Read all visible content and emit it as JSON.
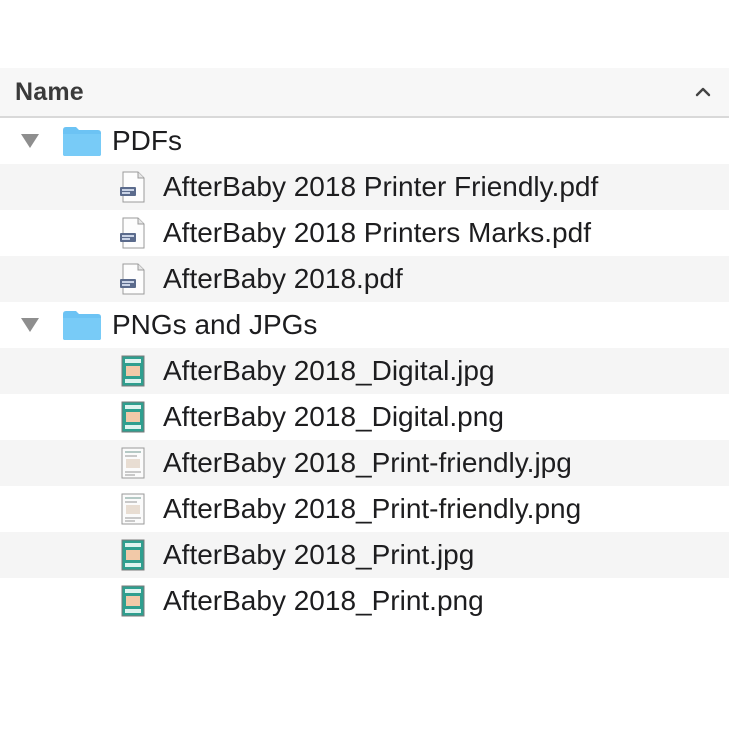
{
  "header": {
    "column_name": "Name",
    "sort_icon": "chevron-up-icon"
  },
  "folders": [
    {
      "name": "PDFs",
      "expanded": true,
      "files": [
        {
          "name": "AfterBaby 2018 Printer Friendly.pdf",
          "icon": "pdf-file-icon"
        },
        {
          "name": "AfterBaby 2018 Printers Marks.pdf",
          "icon": "pdf-file-icon"
        },
        {
          "name": "AfterBaby 2018.pdf",
          "icon": "pdf-file-icon"
        }
      ]
    },
    {
      "name": "PNGs and JPGs",
      "expanded": true,
      "files": [
        {
          "name": "AfterBaby 2018_Digital.jpg",
          "icon": "image-file-icon"
        },
        {
          "name": "AfterBaby 2018_Digital.png",
          "icon": "image-file-icon"
        },
        {
          "name": "AfterBaby 2018_Print-friendly.jpg",
          "icon": "image-file-light-icon"
        },
        {
          "name": "AfterBaby 2018_Print-friendly.png",
          "icon": "image-file-light-icon"
        },
        {
          "name": "AfterBaby 2018_Print.jpg",
          "icon": "image-file-icon"
        },
        {
          "name": "AfterBaby 2018_Print.png",
          "icon": "image-file-icon"
        }
      ]
    }
  ],
  "colors": {
    "folder_blue": "#6cc3f4",
    "row_alt": "#f5f5f5",
    "header_bg": "#f7f7f7",
    "image_teal": "#2f9f8f"
  }
}
